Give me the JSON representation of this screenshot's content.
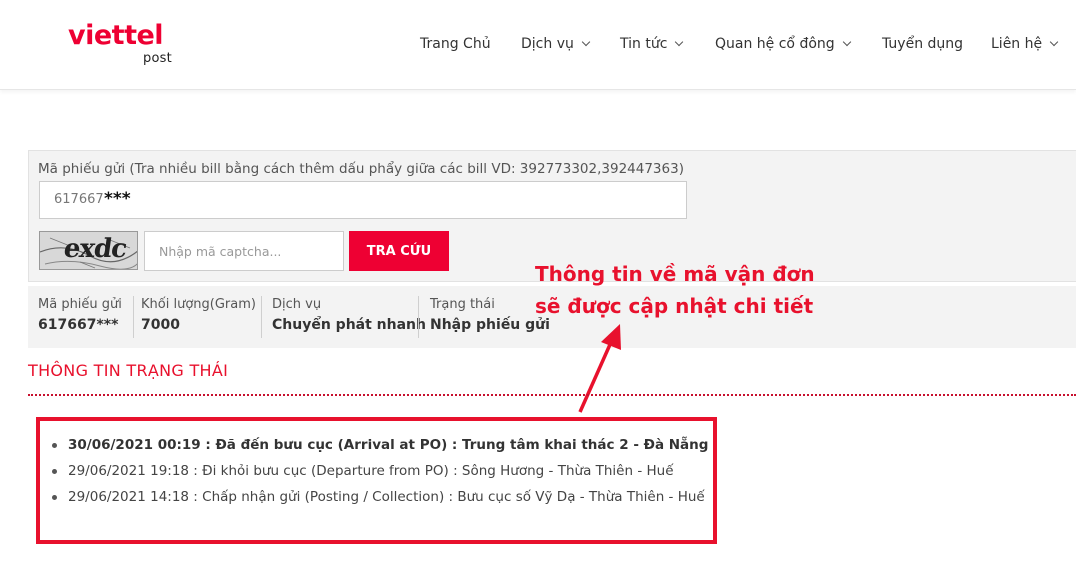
{
  "header": {
    "logo_main": "viettel",
    "logo_sub": "post",
    "nav": [
      {
        "label": "Trang Chủ",
        "has_dropdown": false
      },
      {
        "label": "Dịch vụ",
        "has_dropdown": true
      },
      {
        "label": "Tin tức",
        "has_dropdown": true
      },
      {
        "label": "Quan hệ cổ đông",
        "has_dropdown": true
      },
      {
        "label": "Tuyển dụng",
        "has_dropdown": false
      },
      {
        "label": "Liên hệ",
        "has_dropdown": true
      }
    ]
  },
  "search": {
    "label": "Mã phiếu gửi (Tra nhiều bill bằng cách thêm dấu phẩy giữa các bill VD: 392773302,392447363)",
    "bill_value": "617667",
    "bill_mask": "***",
    "captcha_text": "exdc",
    "captcha_placeholder": "Nhập mã captcha...",
    "button_label": "TRA CỨU"
  },
  "summary": {
    "bill_label": "Mã phiếu gửi",
    "bill_value": "617667***",
    "weight_label": "Khối lượng(Gram)",
    "weight_value": "7000",
    "service_label": "Dịch vụ",
    "service_value": "Chuyển phát nhanh",
    "state_label": "Trạng thái",
    "state_value": "Nhập phiếu gửi"
  },
  "annotation": {
    "line1": "Thông tin về mã vận đơn",
    "line2": "sẽ được cập nhật chi tiết",
    "color": "#e8112d"
  },
  "status": {
    "title": "THÔNG TIN TRẠNG THÁI",
    "events": [
      "30/06/2021 00:19 : Đã đến bưu cục (Arrival at PO) : Trung tâm khai thác 2 - Đà Nẵng",
      "29/06/2021 19:18 : Đi khỏi bưu cục (Departure from PO) : Sông Hương - Thừa Thiên - Huế",
      "29/06/2021 14:18 : Chấp nhận gửi (Posting / Collection) : Bưu cục số Vỹ Dạ - Thừa Thiên - Huế"
    ]
  },
  "colors": {
    "brand": "#ee0033",
    "panel_bg": "#f3f3f3"
  }
}
